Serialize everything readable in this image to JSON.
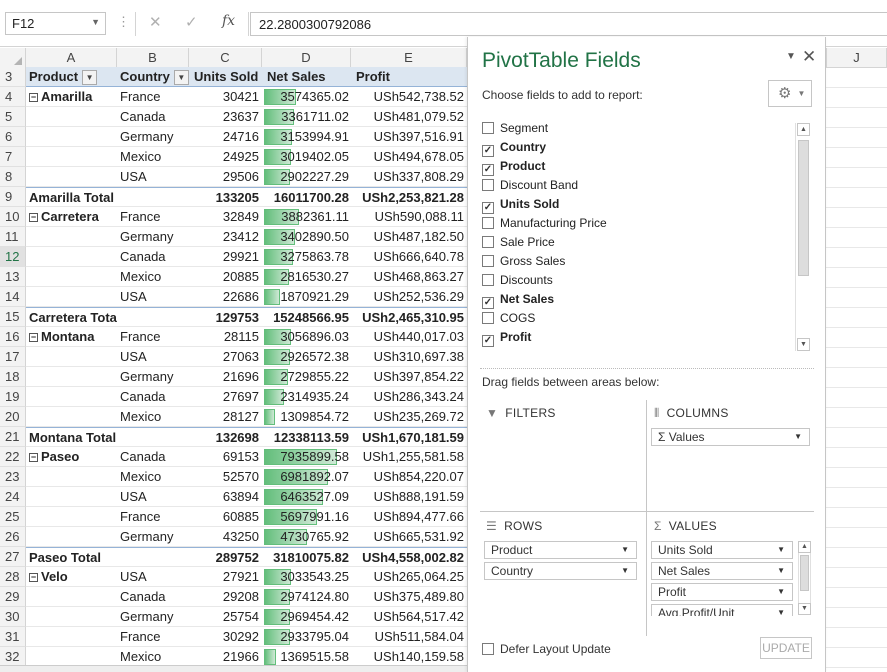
{
  "formula_bar": {
    "name_box": "F12",
    "formula": "22.2800300792086",
    "fx": "fx",
    "cancel": "✕",
    "confirm": "✓"
  },
  "columns": [
    "A",
    "B",
    "C",
    "D",
    "E",
    "J"
  ],
  "row_numbers": [
    "3",
    "4",
    "5",
    "6",
    "7",
    "8",
    "9",
    "10",
    "11",
    "12",
    "13",
    "14",
    "15",
    "16",
    "17",
    "18",
    "19",
    "20",
    "21",
    "22",
    "23",
    "24",
    "25",
    "26",
    "27",
    "28",
    "29",
    "30",
    "31",
    "32"
  ],
  "pivot_headers": {
    "product": "Product",
    "country": "Country",
    "units_sold": "Units Sold",
    "net_sales": "Net Sales",
    "profit": "Profit"
  },
  "pivot_rows": [
    {
      "type": "item",
      "product": "Amarilla",
      "country": "France",
      "units": "30421",
      "net": "3574365.02",
      "profit": "USh542,738.52",
      "bar": 0.44
    },
    {
      "type": "item",
      "product": "",
      "country": "Canada",
      "units": "23637",
      "net": "3361711.02",
      "profit": "USh481,079.52",
      "bar": 0.41
    },
    {
      "type": "item",
      "product": "",
      "country": "Germany",
      "units": "24716",
      "net": "3153994.91",
      "profit": "USh397,516.91",
      "bar": 0.38
    },
    {
      "type": "item",
      "product": "",
      "country": "Mexico",
      "units": "24925",
      "net": "3019402.05",
      "profit": "USh494,678.05",
      "bar": 0.37
    },
    {
      "type": "item",
      "product": "",
      "country": "USA",
      "units": "29506",
      "net": "2902227.29",
      "profit": "USh337,808.29",
      "bar": 0.35
    },
    {
      "type": "total",
      "product": "Amarilla Total",
      "country": "",
      "units": "133205",
      "net": "16011700.28",
      "profit": "USh2,253,821.28",
      "bar": 0
    },
    {
      "type": "item",
      "product": "Carretera",
      "country": "France",
      "units": "32849",
      "net": "3882361.11",
      "profit": "USh590,088.11",
      "bar": 0.48
    },
    {
      "type": "item",
      "product": "",
      "country": "Germany",
      "units": "23412",
      "net": "3402890.50",
      "profit": "USh487,182.50",
      "bar": 0.42
    },
    {
      "type": "item",
      "product": "",
      "country": "Canada",
      "units": "29921",
      "net": "3275863.78",
      "profit": "USh666,640.78",
      "bar": 0.4
    },
    {
      "type": "item",
      "product": "",
      "country": "Mexico",
      "units": "20885",
      "net": "2816530.27",
      "profit": "USh468,863.27",
      "bar": 0.34
    },
    {
      "type": "item",
      "product": "",
      "country": "USA",
      "units": "22686",
      "net": "1870921.29",
      "profit": "USh252,536.29",
      "bar": 0.22
    },
    {
      "type": "total",
      "product": "Carretera Total",
      "country": "",
      "units": "129753",
      "net": "15248566.95",
      "profit": "USh2,465,310.95",
      "bar": 0
    },
    {
      "type": "item",
      "product": "Montana",
      "country": "France",
      "units": "28115",
      "net": "3056896.03",
      "profit": "USh440,017.03",
      "bar": 0.37
    },
    {
      "type": "item",
      "product": "",
      "country": "USA",
      "units": "27063",
      "net": "2926572.38",
      "profit": "USh310,697.38",
      "bar": 0.35
    },
    {
      "type": "item",
      "product": "",
      "country": "Germany",
      "units": "21696",
      "net": "2729855.22",
      "profit": "USh397,854.22",
      "bar": 0.33
    },
    {
      "type": "item",
      "product": "",
      "country": "Canada",
      "units": "27697",
      "net": "2314935.24",
      "profit": "USh286,343.24",
      "bar": 0.27
    },
    {
      "type": "item",
      "product": "",
      "country": "Mexico",
      "units": "28127",
      "net": "1309854.72",
      "profit": "USh235,269.72",
      "bar": 0.15
    },
    {
      "type": "total",
      "product": "Montana Total",
      "country": "",
      "units": "132698",
      "net": "12338113.59",
      "profit": "USh1,670,181.59",
      "bar": 0
    },
    {
      "type": "item",
      "product": "Paseo",
      "country": "Canada",
      "units": "69153",
      "net": "7935899.58",
      "profit": "USh1,255,581.58",
      "bar": 1.0
    },
    {
      "type": "item",
      "product": "",
      "country": "Mexico",
      "units": "52570",
      "net": "6981892.07",
      "profit": "USh854,220.07",
      "bar": 0.88
    },
    {
      "type": "item",
      "product": "",
      "country": "USA",
      "units": "63894",
      "net": "6463527.09",
      "profit": "USh888,191.59",
      "bar": 0.81
    },
    {
      "type": "item",
      "product": "",
      "country": "France",
      "units": "60885",
      "net": "5697991.16",
      "profit": "USh894,477.66",
      "bar": 0.72
    },
    {
      "type": "item",
      "product": "",
      "country": "Germany",
      "units": "43250",
      "net": "4730765.92",
      "profit": "USh665,531.92",
      "bar": 0.59
    },
    {
      "type": "total",
      "product": "Paseo Total",
      "country": "",
      "units": "289752",
      "net": "31810075.82",
      "profit": "USh4,558,002.82",
      "bar": 0
    },
    {
      "type": "item",
      "product": "Velo",
      "country": "USA",
      "units": "27921",
      "net": "3033543.25",
      "profit": "USh265,064.25",
      "bar": 0.37
    },
    {
      "type": "item",
      "product": "",
      "country": "Canada",
      "units": "29208",
      "net": "2974124.80",
      "profit": "USh375,489.80",
      "bar": 0.36
    },
    {
      "type": "item",
      "product": "",
      "country": "Germany",
      "units": "25754",
      "net": "2969454.42",
      "profit": "USh564,517.42",
      "bar": 0.36
    },
    {
      "type": "item",
      "product": "",
      "country": "France",
      "units": "30292",
      "net": "2933795.04",
      "profit": "USh511,584.04",
      "bar": 0.36
    },
    {
      "type": "item",
      "product": "",
      "country": "Mexico",
      "units": "21966",
      "net": "1369515.58",
      "profit": "USh140,159.58",
      "bar": 0.16
    }
  ],
  "pane": {
    "title": "PivotTable Fields",
    "subtitle": "Choose fields to add to report:",
    "fields": [
      {
        "label": "Segment",
        "checked": false
      },
      {
        "label": "Country",
        "checked": true
      },
      {
        "label": "Product",
        "checked": true
      },
      {
        "label": "Discount Band",
        "checked": false
      },
      {
        "label": "Units Sold",
        "checked": true
      },
      {
        "label": "Manufacturing Price",
        "checked": false
      },
      {
        "label": "Sale Price",
        "checked": false
      },
      {
        "label": "Gross Sales",
        "checked": false
      },
      {
        "label": "Discounts",
        "checked": false
      },
      {
        "label": "Net Sales",
        "checked": true
      },
      {
        "label": "COGS",
        "checked": false
      },
      {
        "label": "Profit",
        "checked": true
      }
    ],
    "drag_label": "Drag fields between areas below:",
    "filters_label": "FILTERS",
    "columns_label": "COLUMNS",
    "rows_label": "ROWS",
    "values_label": "VALUES",
    "columns_items": [
      "Σ Values"
    ],
    "rows_items": [
      "Product",
      "Country"
    ],
    "values_items": [
      "Units Sold",
      "Net Sales",
      "Profit",
      "Avg.Profit/Unit"
    ],
    "defer_label": "Defer Layout Update",
    "update_label": "UPDATE"
  }
}
